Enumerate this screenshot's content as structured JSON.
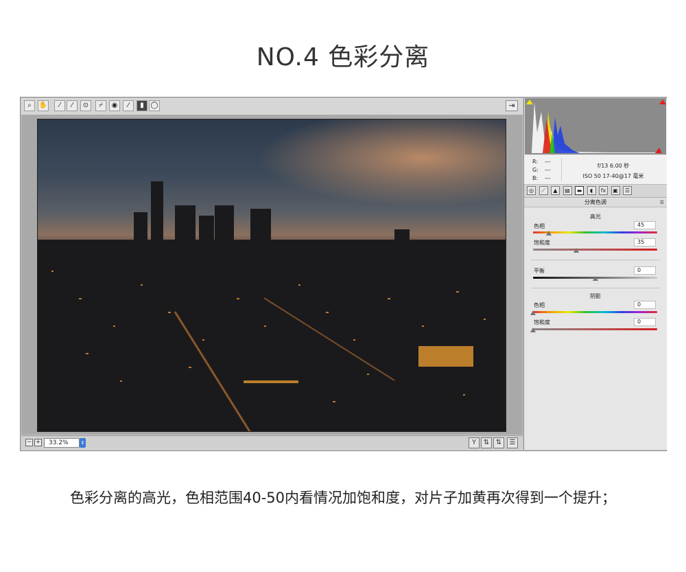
{
  "heading": "NO.4  色彩分离",
  "caption": "色彩分离的高光，色相范围40-50内看情况加饱和度，对片子加黄再次得到一个提升；",
  "toolbar": {
    "tools": [
      {
        "name": "zoom-icon",
        "glyph": "⌕"
      },
      {
        "name": "hand-icon",
        "glyph": "✋"
      },
      {
        "name": "white-balance-icon",
        "glyph": "⁄"
      },
      {
        "name": "color-sampler-icon",
        "glyph": "⁄"
      },
      {
        "name": "target-adjust-icon",
        "glyph": "⊙"
      },
      {
        "name": "crop-icon",
        "glyph": "⌿"
      },
      {
        "name": "red-eye-icon",
        "glyph": "◉"
      },
      {
        "name": "brush-icon",
        "glyph": "⁄"
      },
      {
        "name": "graduated-filter-icon",
        "glyph": "▮"
      },
      {
        "name": "radial-filter-icon",
        "glyph": "◯"
      }
    ]
  },
  "status": {
    "zoom": "33.2%"
  },
  "exif": {
    "r_label": "R:",
    "g_label": "G:",
    "b_label": "B:",
    "r_value": "---",
    "g_value": "---",
    "b_value": "---",
    "line1": "f/13   6.00 秒",
    "line2": "ISO 50    17-40@17 毫米"
  },
  "panel": {
    "section_title": "分离色调",
    "highlights": {
      "title": "高光",
      "hue_label": "色相",
      "hue_value": "45",
      "hue": 45,
      "hue_max": 360,
      "sat_label": "饱和度",
      "sat_value": "35",
      "sat": 35,
      "sat_max": 100
    },
    "balance": {
      "label": "平衡",
      "value": "0",
      "level": 0,
      "min": -100,
      "max": 100
    },
    "shadows": {
      "title": "阴影",
      "hue_label": "色相",
      "hue_value": "0",
      "hue": 0,
      "sat_label": "饱和度",
      "sat_value": "0",
      "sat": 0
    }
  },
  "tabs": [
    "basic-tab-icon",
    "tone-curve-tab-icon",
    "detail-tab-icon",
    "hsl-tab-icon",
    "split-toning-tab-icon",
    "lens-corrections-tab-icon",
    "effects-tab-icon",
    "camera-calibration-tab-icon",
    "presets-tab-icon"
  ],
  "tab_glyphs": [
    "◎",
    "⟋",
    "▲",
    "▤",
    "▬",
    "◖",
    "fx",
    "▣",
    "☰"
  ]
}
